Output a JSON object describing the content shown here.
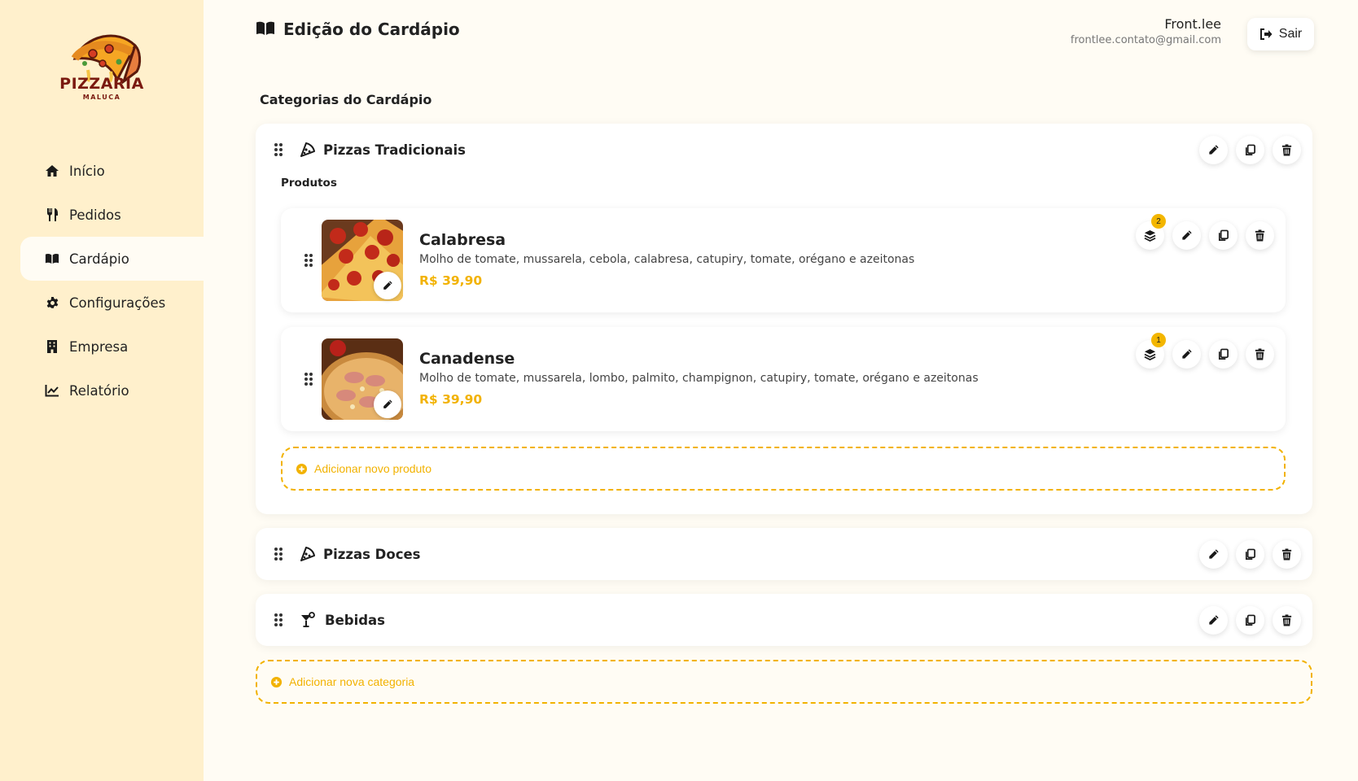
{
  "brand": {
    "name": "PIZZARIA",
    "tagline": "MALUCA"
  },
  "sidebar": {
    "items": [
      {
        "label": "Início",
        "icon": "home-icon"
      },
      {
        "label": "Pedidos",
        "icon": "utensils-icon"
      },
      {
        "label": "Cardápio",
        "icon": "book-open-icon",
        "active": true
      },
      {
        "label": "Configurações",
        "icon": "gear-icon"
      },
      {
        "label": "Empresa",
        "icon": "building-icon"
      },
      {
        "label": "Relatório",
        "icon": "chart-line-icon"
      }
    ]
  },
  "header": {
    "title": "Edição do Cardápio",
    "user_name": "Front.lee",
    "user_email": "frontlee.contato@gmail.com",
    "logout_label": "Sair"
  },
  "main": {
    "section_title": "Categorias do Cardápio",
    "products_label": "Produtos",
    "categories": [
      {
        "name": "Pizzas Tradicionais",
        "icon": "pizza-slice-icon"
      },
      {
        "name": "Pizzas Doces",
        "icon": "pizza-slice-icon"
      },
      {
        "name": "Bebidas",
        "icon": "cocktail-icon"
      }
    ],
    "products": [
      {
        "name": "Calabresa",
        "description": "Molho de tomate, mussarela, cebola, calabresa, catupiry, tomate, orégano e azeitonas",
        "price": "R$ 39,90",
        "addons_count": "2"
      },
      {
        "name": "Canadense",
        "description": "Molho de tomate, mussarela, lombo, palmito, champignon, catupiry, tomate, orégano e azeitonas",
        "price": "R$ 39,90",
        "addons_count": "1"
      }
    ],
    "add_product_label": "Adicionar novo produto",
    "add_category_label": "Adicionar nova categoria"
  },
  "colors": {
    "sidebar_bg": "#fff0cc",
    "page_bg": "#fffcf4",
    "accent": "#f2b200",
    "text": "#222222"
  }
}
